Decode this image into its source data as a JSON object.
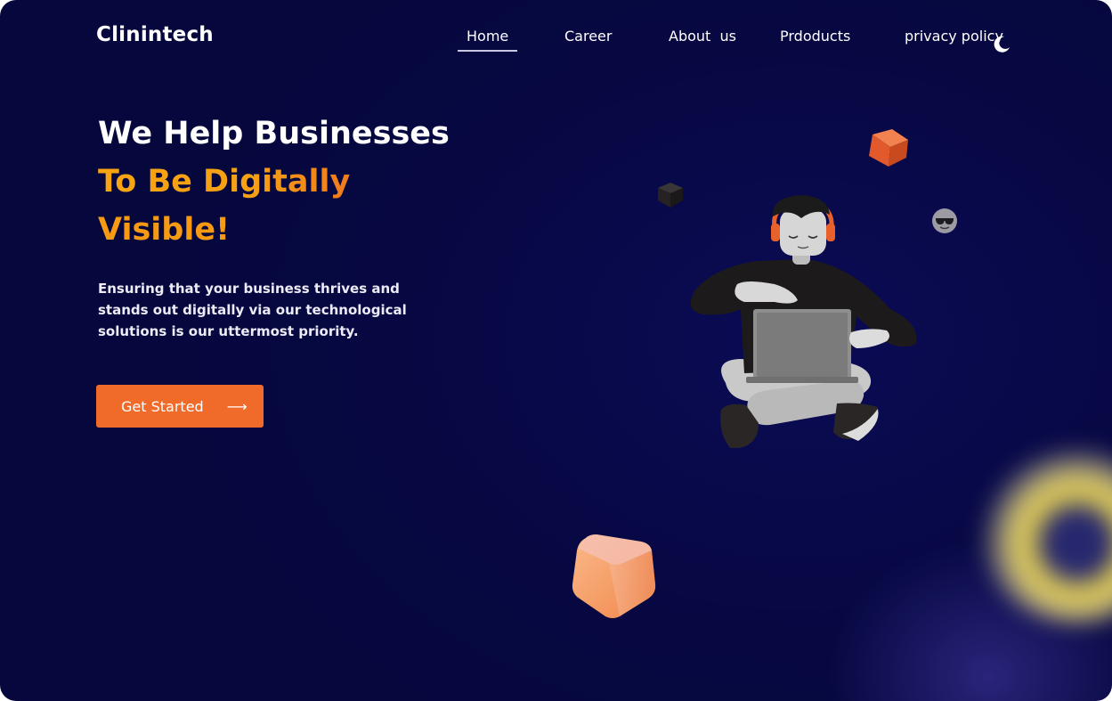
{
  "brand": {
    "name": "Clinintech"
  },
  "nav": {
    "items": [
      {
        "label": "Home",
        "active": true
      },
      {
        "label": "Career",
        "active": false
      },
      {
        "label": "About  us",
        "active": false
      },
      {
        "label": "Prdoducts",
        "active": false
      },
      {
        "label": "privacy policy",
        "active": false
      }
    ],
    "theme_toggle_icon": "moon-icon"
  },
  "hero": {
    "line1": "We Help Businesses",
    "line2": "To Be Digitally",
    "line3": "Visible!",
    "subtitle": "Ensuring that your business thrives and stands out digitally via our technological solutions is our uttermost priority.",
    "cta_label": "Get Started",
    "cta_icon": "arrow-right-icon"
  },
  "colors": {
    "background": "#07084a",
    "accent_orange": "#f06a2a",
    "headline_orange": "#f59a12",
    "text_white": "#ffffff"
  },
  "illustration": {
    "subject": "person-with-laptop-illustration",
    "decorations": [
      "orange-cube",
      "dark-cube",
      "sunglasses-emoji",
      "peach-cube",
      "blurred-yellow-ring"
    ]
  }
}
